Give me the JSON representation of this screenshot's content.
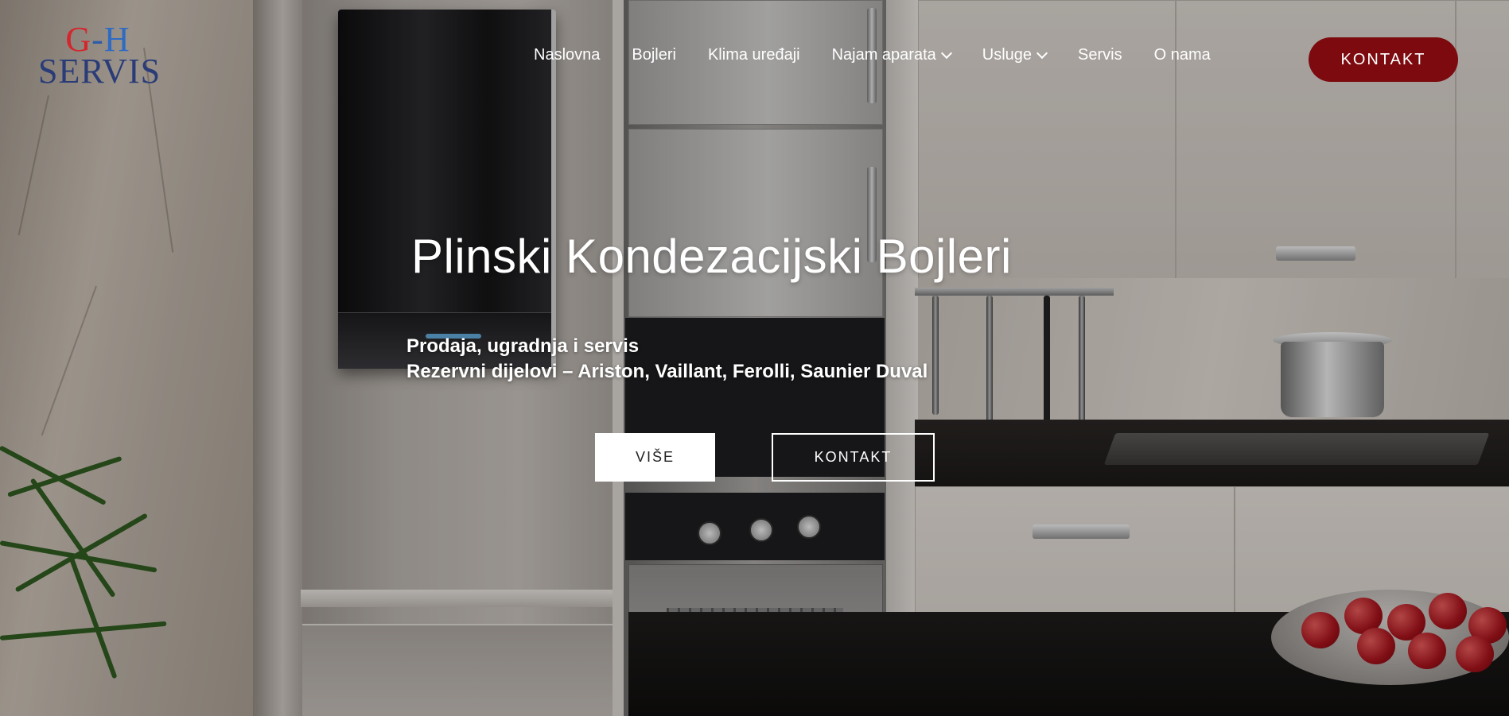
{
  "logo": {
    "top_g": "G",
    "top_dash": "-",
    "top_h": "H",
    "bottom": "SERVIS"
  },
  "nav": {
    "items": [
      {
        "label": "Naslovna",
        "has_dropdown": false
      },
      {
        "label": "Bojleri",
        "has_dropdown": false
      },
      {
        "label": "Klima uređaji",
        "has_dropdown": false
      },
      {
        "label": "Najam aparata",
        "has_dropdown": true
      },
      {
        "label": "Usluge",
        "has_dropdown": true
      },
      {
        "label": "Servis",
        "has_dropdown": false
      },
      {
        "label": "O nama",
        "has_dropdown": false
      }
    ],
    "cta_label": "KONTAKT"
  },
  "hero": {
    "title": "Plinski Kondezacijski Bojleri",
    "subtitle_line1": "Prodaja, ugradnja i servis",
    "subtitle_line2": "Rezervni dijelovi – Ariston, Vaillant, Ferolli, Saunier Duval",
    "button_more": "VIŠE",
    "button_contact": "KONTAKT"
  },
  "colors": {
    "cta_background": "#7c0a0e",
    "logo_red": "#d4262c",
    "logo_blue": "#2a3c78"
  }
}
